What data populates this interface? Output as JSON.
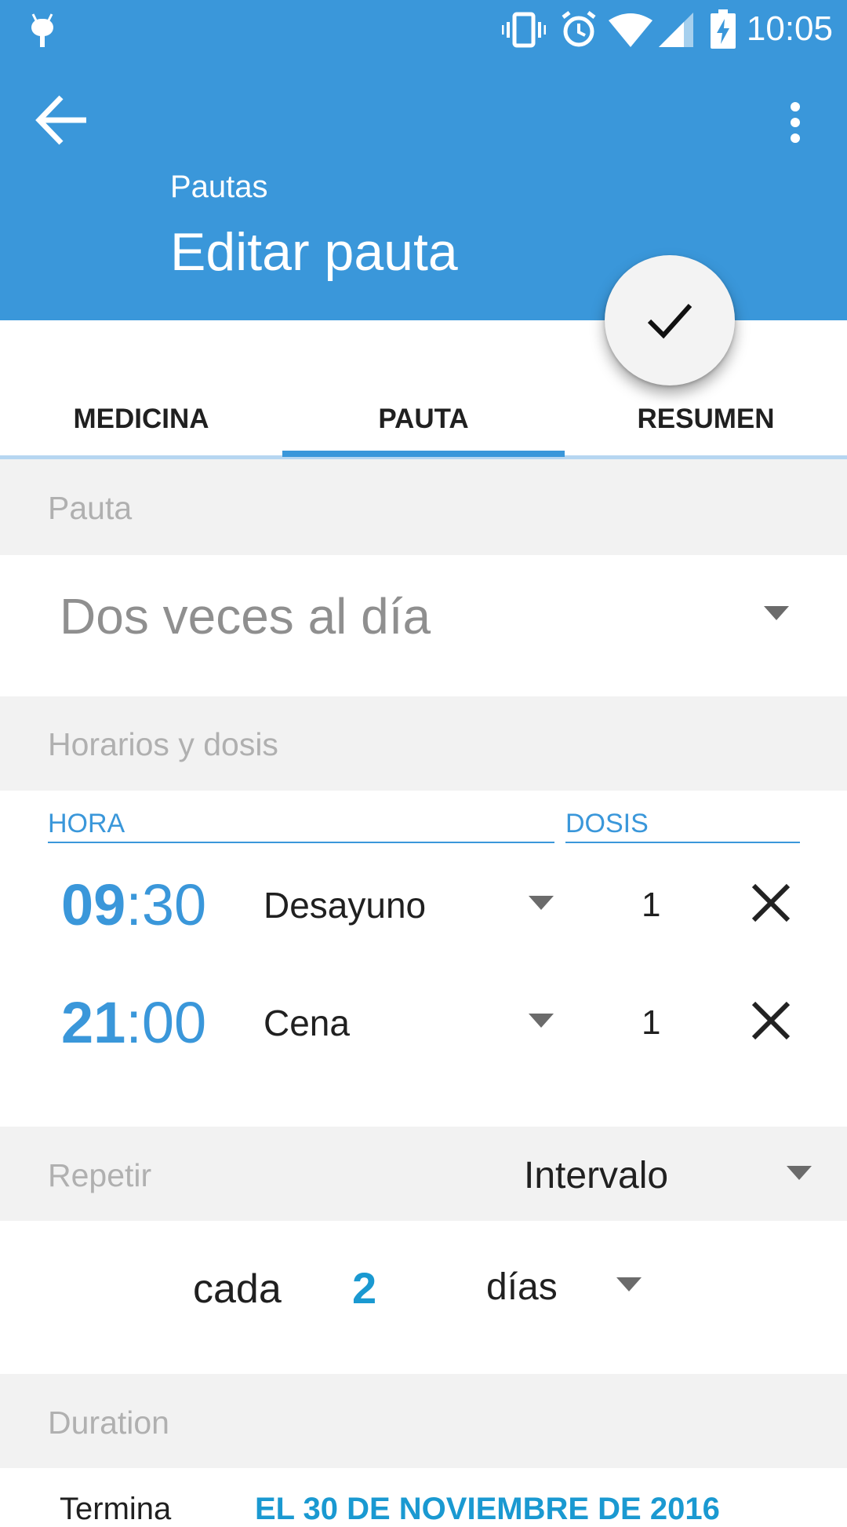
{
  "status_bar": {
    "time": "10:05"
  },
  "app_bar": {
    "subtitle": "Pautas",
    "title": "Editar pauta",
    "back_icon": "arrow-left-icon",
    "more_icon": "more-vert-icon",
    "fab_icon": "check-icon",
    "color": "#3a97da"
  },
  "tabs": [
    {
      "label": "MEDICINA",
      "selected": false
    },
    {
      "label": "PAUTA",
      "selected": true
    },
    {
      "label": "RESUMEN",
      "selected": false
    }
  ],
  "pauta_section": {
    "label": "Pauta",
    "selected_value": "Dos veces al día"
  },
  "schedule_section": {
    "label": "Horarios y dosis",
    "col_hour": "HORA",
    "col_dose": "DOSIS",
    "rows": [
      {
        "time_h": "09",
        "time_sep": ":",
        "time_m": "30",
        "meal": "Desayuno",
        "dose": "1"
      },
      {
        "time_h": "21",
        "time_sep": ":",
        "time_m": "00",
        "meal": "Cena",
        "dose": "1"
      }
    ]
  },
  "repeat_section": {
    "label": "Repetir",
    "value": "Intervalo",
    "every_label": "cada",
    "every_number": "2",
    "every_unit": "días"
  },
  "duration_section": {
    "label": "Duration",
    "end_label": "Termina",
    "end_value": "EL 30 DE NOVIEMBRE DE 2016"
  }
}
